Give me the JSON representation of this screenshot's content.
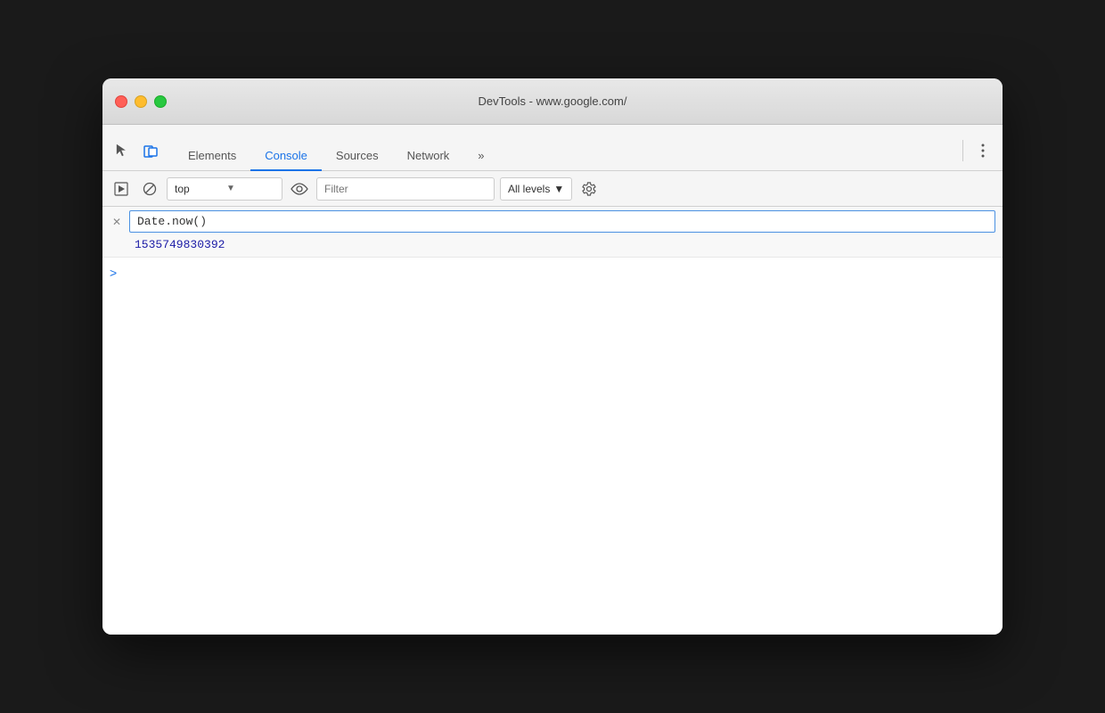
{
  "window": {
    "title": "DevTools - www.google.com/"
  },
  "controls": {
    "close": "close",
    "minimize": "minimize",
    "maximize": "maximize"
  },
  "tabs": [
    {
      "id": "elements",
      "label": "Elements",
      "active": false
    },
    {
      "id": "console",
      "label": "Console",
      "active": true
    },
    {
      "id": "sources",
      "label": "Sources",
      "active": false
    },
    {
      "id": "network",
      "label": "Network",
      "active": false
    },
    {
      "id": "more",
      "label": "»",
      "active": false
    }
  ],
  "toolbar": {
    "context_value": "top",
    "context_placeholder": "top",
    "filter_placeholder": "Filter",
    "levels_label": "All levels",
    "levels_arrow": "▼"
  },
  "console": {
    "input_value": "Date.now()",
    "result_value": "1535749830392",
    "prompt_symbol": ">"
  }
}
